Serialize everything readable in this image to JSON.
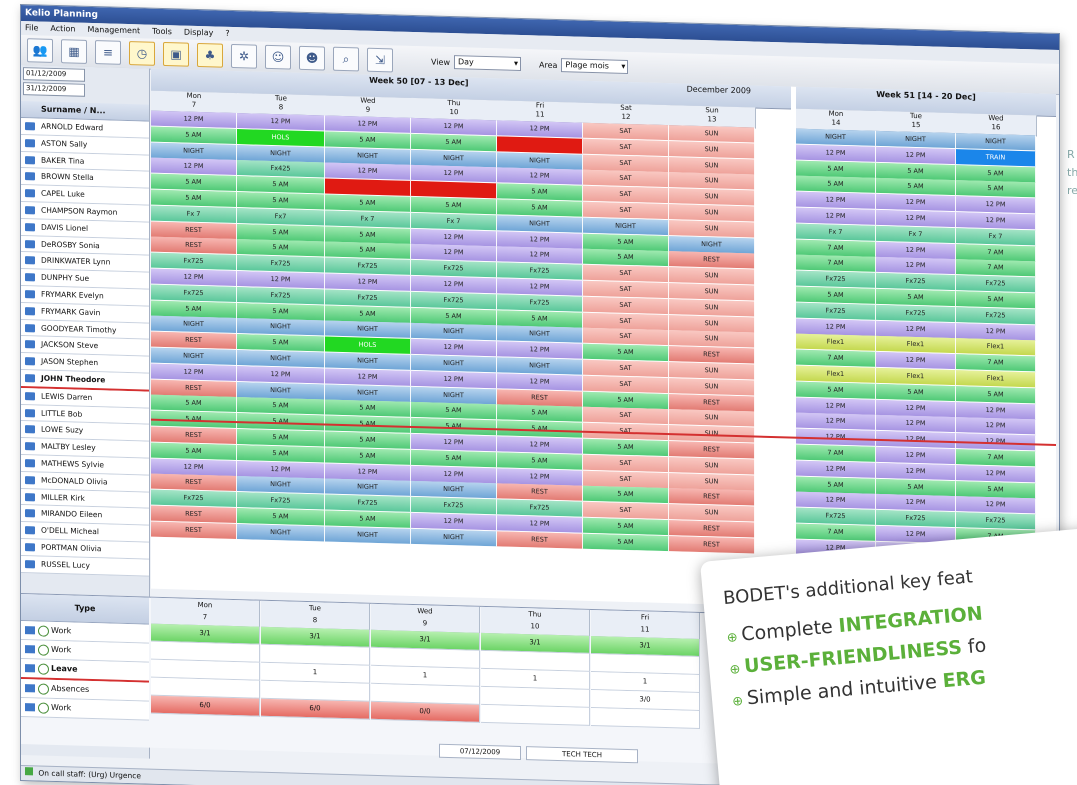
{
  "window": {
    "title": "Kelio Planning"
  },
  "menu": [
    "File",
    "Action",
    "Management",
    "Tools",
    "Display",
    "?"
  ],
  "toolbar": {
    "view_label": "View",
    "view_value": "Day",
    "area_label": "Area",
    "area_value": "Plage mois"
  },
  "dates": [
    "01/12/2009",
    "31/12/2009"
  ],
  "left_header": "Surname / N...",
  "employees": [
    "ARNOLD Edward",
    "ASTON Sally",
    "BAKER Tina",
    "BROWN Stella",
    "CAPEL Luke",
    "CHAMPSON Raymon",
    "DAVIS Lionel",
    "DeROSBY Sonia",
    "DRINKWATER Lynn",
    "DUNPHY Sue",
    "FRYMARK Evelyn",
    "FRYMARK Gavin",
    "GOODYEAR Timothy",
    "JACKSON Steve",
    "JASON Stephen",
    "JOHN Theodore",
    "LEWIS Darren",
    "LITTLE Bob",
    "LOWE Suzy",
    "MALTBY Lesley",
    "MATHEWS Sylvie",
    "McDONALD Olivia",
    "MILLER Kirk",
    "MIRANDO Eileen",
    "O'DELL Micheal",
    "PORTMAN Olivia",
    "RUSSEL Lucy"
  ],
  "week30": "Week 50 [07 - 13 Dec]",
  "week31": "Week 51 [14 - 20 Dec]",
  "month": "December 2009",
  "days": [
    [
      "Mon",
      "7"
    ],
    [
      "Tue",
      "8"
    ],
    [
      "Wed",
      "9"
    ],
    [
      "Thu",
      "10"
    ],
    [
      "Fri",
      "11"
    ],
    [
      "Sat",
      "12"
    ],
    [
      "Sun",
      "13"
    ],
    [
      "Mon",
      "14"
    ],
    [
      "Tue",
      "15"
    ],
    [
      "Wed",
      "16"
    ]
  ],
  "shifts": [
    [
      "12 PM",
      "12 PM",
      "12 PM",
      "12 PM",
      "12 PM",
      "SAT",
      "SUN",
      "NIGHT",
      "NIGHT",
      "NIGHT"
    ],
    [
      "5 AM",
      "HOLS",
      "5 AM",
      "5 AM",
      "",
      "SAT",
      "SUN",
      "12 PM",
      "12 PM",
      "TRAIN"
    ],
    [
      "NIGHT",
      "NIGHT",
      "NIGHT",
      "NIGHT",
      "NIGHT",
      "SAT",
      "SUN",
      "5 AM",
      "5 AM",
      "5 AM"
    ],
    [
      "12 PM",
      "Fx425",
      "12 PM",
      "12 PM",
      "12 PM",
      "SAT",
      "SUN",
      "5 AM",
      "5 AM",
      "5 AM"
    ],
    [
      "5 AM",
      "5 AM",
      "",
      "",
      "5 AM",
      "SAT",
      "SUN",
      "12 PM",
      "12 PM",
      "12 PM"
    ],
    [
      "5 AM",
      "5 AM",
      "5 AM",
      "5 AM",
      "5 AM",
      "SAT",
      "SUN",
      "12 PM",
      "12 PM",
      "12 PM"
    ],
    [
      "Fx 7",
      "Fx7",
      "Fx 7",
      "Fx 7",
      "NIGHT",
      "NIGHT",
      "SUN",
      "Fx 7",
      "Fx 7",
      "Fx 7"
    ],
    [
      "REST",
      "5 AM",
      "5 AM",
      "12 PM",
      "12 PM",
      "5 AM",
      "NIGHT",
      "7 AM",
      "12 PM",
      "7 AM"
    ],
    [
      "REST",
      "5 AM",
      "5 AM",
      "12 PM",
      "12 PM",
      "5 AM",
      "REST",
      "7 AM",
      "12 PM",
      "7 AM"
    ],
    [
      "Fx725",
      "Fx725",
      "Fx725",
      "Fx725",
      "Fx725",
      "SAT",
      "SUN",
      "Fx725",
      "Fx725",
      "Fx725"
    ],
    [
      "12 PM",
      "12 PM",
      "12 PM",
      "12 PM",
      "12 PM",
      "SAT",
      "SUN",
      "5 AM",
      "5 AM",
      "5 AM"
    ],
    [
      "Fx725",
      "Fx725",
      "Fx725",
      "Fx725",
      "Fx725",
      "SAT",
      "SUN",
      "Fx725",
      "Fx725",
      "Fx725"
    ],
    [
      "5 AM",
      "5 AM",
      "5 AM",
      "5 AM",
      "5 AM",
      "SAT",
      "SUN",
      "12 PM",
      "12 PM",
      "12 PM"
    ],
    [
      "NIGHT",
      "NIGHT",
      "NIGHT",
      "NIGHT",
      "NIGHT",
      "SAT",
      "SUN",
      "Flex1",
      "Flex1",
      "Flex1"
    ],
    [
      "REST",
      "5 AM",
      "HOLS",
      "12 PM",
      "12 PM",
      "5 AM",
      "REST",
      "7 AM",
      "12 PM",
      "7 AM"
    ],
    [
      "NIGHT",
      "NIGHT",
      "NIGHT",
      "NIGHT",
      "NIGHT",
      "SAT",
      "SUN",
      "Flex1",
      "Flex1",
      "Flex1"
    ],
    [
      "12 PM",
      "12 PM",
      "12 PM",
      "12 PM",
      "12 PM",
      "SAT",
      "SUN",
      "5 AM",
      "5 AM",
      "5 AM"
    ],
    [
      "REST",
      "NIGHT",
      "NIGHT",
      "NIGHT",
      "REST",
      "5 AM",
      "REST",
      "12 PM",
      "12 PM",
      "12 PM"
    ],
    [
      "5 AM",
      "5 AM",
      "5 AM",
      "5 AM",
      "5 AM",
      "SAT",
      "SUN",
      "12 PM",
      "12 PM",
      "12 PM"
    ],
    [
      "5 AM",
      "5 AM",
      "5 AM",
      "5 AM",
      "5 AM",
      "SAT",
      "SUN",
      "12 PM",
      "12 PM",
      "12 PM"
    ],
    [
      "REST",
      "5 AM",
      "5 AM",
      "12 PM",
      "12 PM",
      "5 AM",
      "REST",
      "7 AM",
      "12 PM",
      "7 AM"
    ],
    [
      "5 AM",
      "5 AM",
      "5 AM",
      "5 AM",
      "5 AM",
      "SAT",
      "SUN",
      "12 PM",
      "12 PM",
      "12 PM"
    ],
    [
      "12 PM",
      "12 PM",
      "12 PM",
      "12 PM",
      "12 PM",
      "SAT",
      "SUN",
      "5 AM",
      "5 AM",
      "5 AM"
    ],
    [
      "REST",
      "NIGHT",
      "NIGHT",
      "NIGHT",
      "REST",
      "5 AM",
      "REST",
      "12 PM",
      "12 PM",
      "12 PM"
    ],
    [
      "Fx725",
      "Fx725",
      "Fx725",
      "Fx725",
      "Fx725",
      "SAT",
      "SUN",
      "Fx725",
      "Fx725",
      "Fx725"
    ],
    [
      "REST",
      "5 AM",
      "5 AM",
      "12 PM",
      "12 PM",
      "5 AM",
      "REST",
      "7 AM",
      "12 PM",
      "7 AM"
    ],
    [
      "REST",
      "NIGHT",
      "NIGHT",
      "NIGHT",
      "REST",
      "5 AM",
      "REST",
      "12 PM",
      "12 PM",
      "12 PM"
    ]
  ],
  "bottom": {
    "type_header": "Type",
    "types": [
      "Work",
      "Work",
      "Leave",
      "Absences",
      "Work"
    ],
    "days": [
      [
        "Mon",
        "7"
      ],
      [
        "Tue",
        "8"
      ],
      [
        "Wed",
        "9"
      ],
      [
        "Thu",
        "10"
      ],
      [
        "Fri",
        "11"
      ]
    ],
    "values": [
      [
        "3/1",
        "3/1",
        "3/1",
        "3/1",
        "3/1"
      ],
      [
        "",
        "",
        "",
        "",
        ""
      ],
      [
        "",
        "1",
        "1",
        "1",
        "1"
      ],
      [
        "",
        "",
        "",
        "",
        "3/0"
      ],
      [
        "6/0",
        "6/0",
        "0/0",
        "",
        ""
      ]
    ],
    "date": "07/12/2009",
    "user": "TECH TECH"
  },
  "status": "On call staff: (Urg) Urgence",
  "callout": {
    "title": "BODET's additional key feat",
    "lines": [
      [
        "Complete ",
        "INTEGRATION",
        ""
      ],
      [
        "",
        "USER-FRIENDLINESS",
        " fo"
      ],
      [
        "Simple and intuitive ",
        "ERG",
        ""
      ]
    ]
  },
  "side_note": "R\nth\nre",
  "colors": {
    "am": "#4fc976",
    "pm": "#a694e2",
    "night": "#6fa5d6",
    "rest": "#e27b73",
    "weekend": "#eea29a",
    "accent": "#5bb03a"
  }
}
